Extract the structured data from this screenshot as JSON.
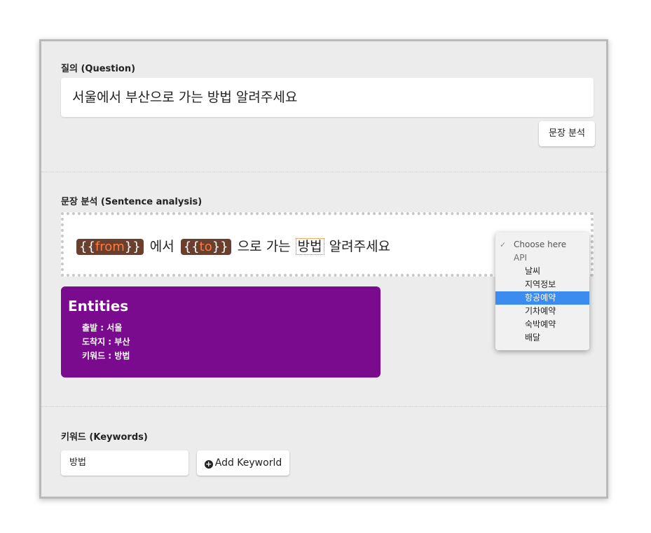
{
  "question": {
    "label": "질의 (Question)",
    "value": "서울에서 부산으로 가는 방법 알려주세요",
    "analyze_button": "문장 분석"
  },
  "analysis": {
    "label": "문장 분석 (Sentence analysis)",
    "tokens": [
      {
        "var": "from"
      },
      {
        "text": "에서"
      },
      {
        "var": "to"
      },
      {
        "text": "으로 가는"
      },
      {
        "keyword": "방법"
      },
      {
        "text": "알려주세요"
      }
    ],
    "dropdown": {
      "placeholder": "Choose here",
      "group": "API",
      "options": [
        "날씨",
        "지역정보",
        "항공예약",
        "기차예약",
        "숙박예약",
        "배달"
      ],
      "selected_index": 2
    }
  },
  "entities": {
    "title": "Entities",
    "items": [
      "출발 : 서울",
      "도착지 : 부산",
      "키워드 : 방법"
    ]
  },
  "keywords": {
    "label": "키워드 (Keywords)",
    "input_value": "방법",
    "add_button": "Add Keyworld"
  }
}
